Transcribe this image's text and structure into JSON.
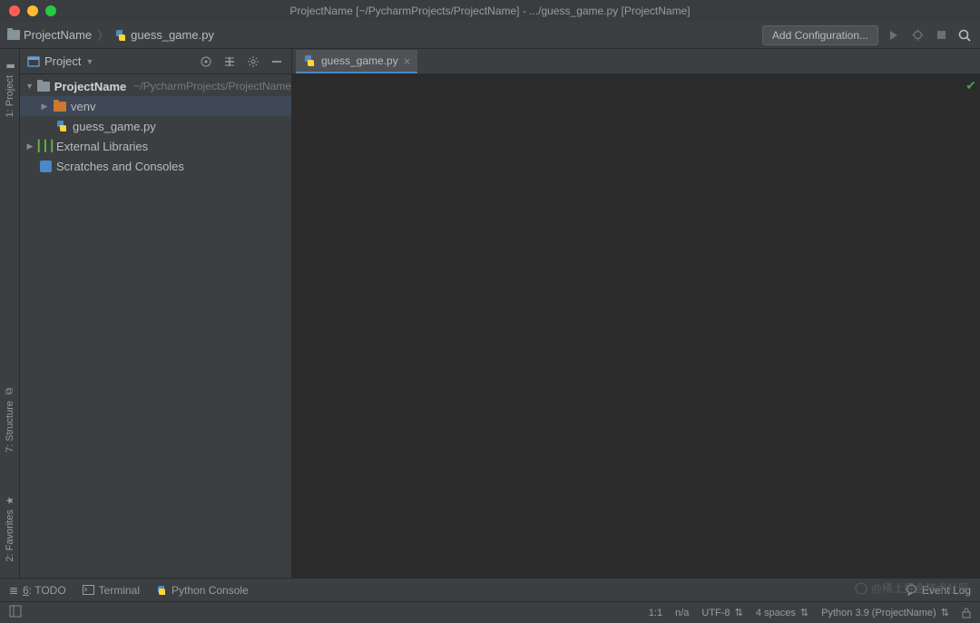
{
  "window": {
    "title": "ProjectName [~/PycharmProjects/ProjectName] - .../guess_game.py [ProjectName]"
  },
  "breadcrumb": {
    "project": "ProjectName",
    "file": "guess_game.py"
  },
  "navbar": {
    "add_config": "Add Configuration..."
  },
  "leftrail": {
    "project": "1: Project",
    "structure": "7: Structure",
    "favorites": "2: Favorites"
  },
  "project_panel": {
    "title": "Project",
    "tree": {
      "root": "ProjectName",
      "root_path": "~/PycharmProjects/ProjectName",
      "venv": "venv",
      "file": "guess_game.py",
      "external": "External Libraries",
      "scratches": "Scratches and Consoles"
    }
  },
  "editor": {
    "tab": "guess_game.py"
  },
  "bottom_tools": {
    "todo": "6: TODO",
    "terminal": "Terminal",
    "python_console": "Python Console",
    "event_log": "Event Log"
  },
  "statusbar": {
    "pos": "1:1",
    "lf": "n/a",
    "encoding": "UTF-8",
    "indent": "4 spaces",
    "interpreter": "Python 3.9 (ProjectName)"
  },
  "watermark": "@稀土掘金技术社区"
}
